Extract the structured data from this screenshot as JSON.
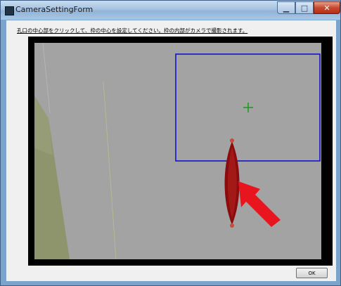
{
  "window": {
    "title": "CameraSettingForm",
    "controls": {
      "minimize": "▁",
      "maximize": "□",
      "close": "✕"
    }
  },
  "instruction": "孔口の中心部をクリックして、枠の中心を設定してください。枠の内部がカメラで撮影されます。",
  "buttons": {
    "ok": "OK"
  },
  "colors": {
    "selection_frame": "#1414c8",
    "center_marker": "#1f9a1f",
    "arrow": "#e8141e",
    "object": "#8a0c0c",
    "view_background": "#a3a3a3"
  },
  "icons": {
    "center_marker": "plus-crosshair-icon",
    "arrow": "red-arrow-icon"
  }
}
